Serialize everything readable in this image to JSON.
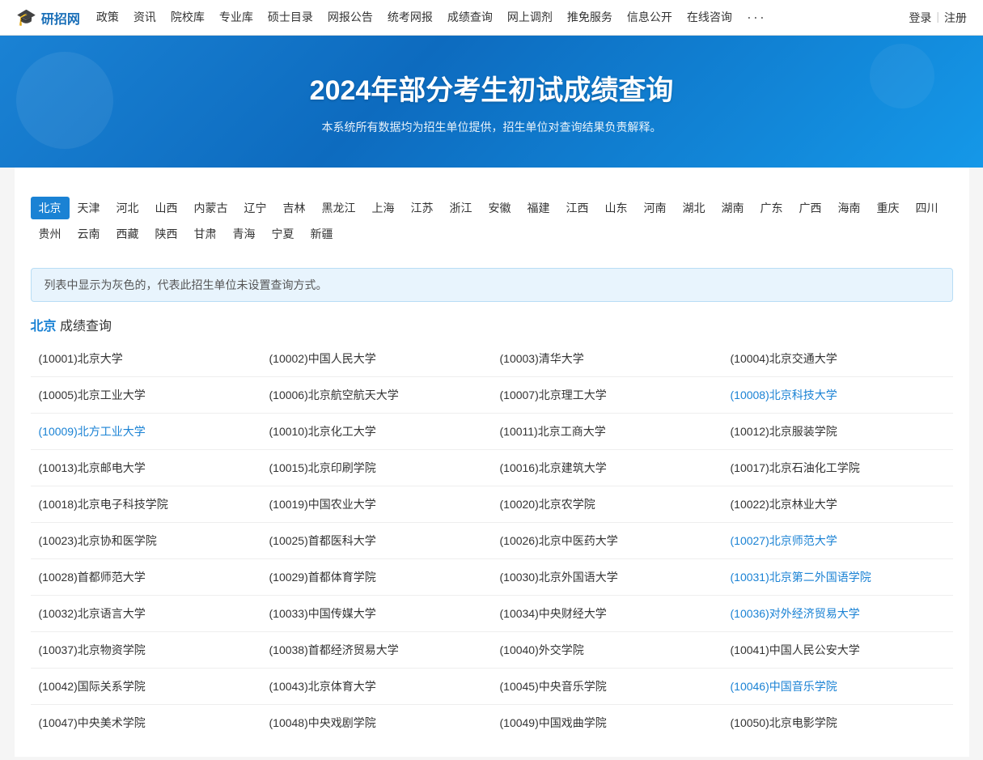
{
  "nav": {
    "logo_text": "研招网",
    "links": [
      "政策",
      "资讯",
      "院校库",
      "专业库",
      "硕士目录",
      "网报公告",
      "统考网报",
      "成绩查询",
      "网上调剂",
      "推免服务",
      "信息公开",
      "在线咨询"
    ],
    "more": "···",
    "login": "登录",
    "separator": "|",
    "register": "注册"
  },
  "hero": {
    "title": "2024年部分考生初试成绩查询",
    "subtitle": "本系统所有数据均为招生单位提供，招生单位对查询结果负责解释。"
  },
  "provinces": {
    "row1": [
      "北京",
      "天津",
      "河北",
      "山西",
      "内蒙古",
      "辽宁",
      "吉林",
      "黑龙江",
      "上海",
      "江苏",
      "浙江",
      "安徽",
      "福建",
      "江西",
      "山东",
      "河南",
      "湖北",
      "湖南",
      "广东",
      "广西",
      "海南",
      "重庆",
      "四川"
    ],
    "row2": [
      "贵州",
      "云南",
      "西藏",
      "陕西",
      "甘肃",
      "青海",
      "宁夏",
      "新疆"
    ],
    "active": "北京"
  },
  "notice": "列表中显示为灰色的，代表此招生单位未设置查询方式。",
  "section": {
    "city": "北京",
    "label": " 成绩查询"
  },
  "universities": [
    {
      "code": "10001",
      "name": "北京大学",
      "link": false
    },
    {
      "code": "10002",
      "name": "中国人民大学",
      "link": false
    },
    {
      "code": "10003",
      "name": "清华大学",
      "link": false
    },
    {
      "code": "10004",
      "name": "北京交通大学",
      "link": false
    },
    {
      "code": "10005",
      "name": "北京工业大学",
      "link": false
    },
    {
      "code": "10006",
      "name": "北京航空航天大学",
      "link": false
    },
    {
      "code": "10007",
      "name": "北京理工大学",
      "link": false
    },
    {
      "code": "10008",
      "name": "北京科技大学",
      "link": true
    },
    {
      "code": "10009",
      "name": "北方工业大学",
      "link": true
    },
    {
      "code": "10010",
      "name": "北京化工大学",
      "link": false
    },
    {
      "code": "10011",
      "name": "北京工商大学",
      "link": false
    },
    {
      "code": "10012",
      "name": "北京服装学院",
      "link": false
    },
    {
      "code": "10013",
      "name": "北京邮电大学",
      "link": false
    },
    {
      "code": "10015",
      "name": "北京印刷学院",
      "link": false
    },
    {
      "code": "10016",
      "name": "北京建筑大学",
      "link": false
    },
    {
      "code": "10017",
      "name": "北京石油化工学院",
      "link": false
    },
    {
      "code": "10018",
      "name": "北京电子科技学院",
      "link": false
    },
    {
      "code": "10019",
      "name": "中国农业大学",
      "link": false
    },
    {
      "code": "10020",
      "name": "北京农学院",
      "link": false
    },
    {
      "code": "10022",
      "name": "北京林业大学",
      "link": false
    },
    {
      "code": "10023",
      "name": "北京协和医学院",
      "link": false
    },
    {
      "code": "10025",
      "name": "首都医科大学",
      "link": false
    },
    {
      "code": "10026",
      "name": "北京中医药大学",
      "link": false
    },
    {
      "code": "10027",
      "name": "北京师范大学",
      "link": true
    },
    {
      "code": "10028",
      "name": "首都师范大学",
      "link": false
    },
    {
      "code": "10029",
      "name": "首都体育学院",
      "link": false
    },
    {
      "code": "10030",
      "name": "北京外国语大学",
      "link": false
    },
    {
      "code": "10031",
      "name": "北京第二外国语学院",
      "link": true
    },
    {
      "code": "10032",
      "name": "北京语言大学",
      "link": false
    },
    {
      "code": "10033",
      "name": "中国传媒大学",
      "link": false
    },
    {
      "code": "10034",
      "name": "中央财经大学",
      "link": false
    },
    {
      "code": "10036",
      "name": "对外经济贸易大学",
      "link": true
    },
    {
      "code": "10037",
      "name": "北京物资学院",
      "link": false
    },
    {
      "code": "10038",
      "name": "首都经济贸易大学",
      "link": false
    },
    {
      "code": "10040",
      "name": "外交学院",
      "link": false
    },
    {
      "code": "10041",
      "name": "中国人民公安大学",
      "link": false
    },
    {
      "code": "10042",
      "name": "国际关系学院",
      "link": false
    },
    {
      "code": "10043",
      "name": "北京体育大学",
      "link": false
    },
    {
      "code": "10045",
      "name": "中央音乐学院",
      "link": false
    },
    {
      "code": "10046",
      "name": "中国音乐学院",
      "link": true
    },
    {
      "code": "10047",
      "name": "中央美术学院",
      "link": false
    },
    {
      "code": "10048",
      "name": "中央戏剧学院",
      "link": false
    },
    {
      "code": "10049",
      "name": "中国戏曲学院",
      "link": false
    },
    {
      "code": "10050",
      "name": "北京电影学院",
      "link": false
    }
  ]
}
